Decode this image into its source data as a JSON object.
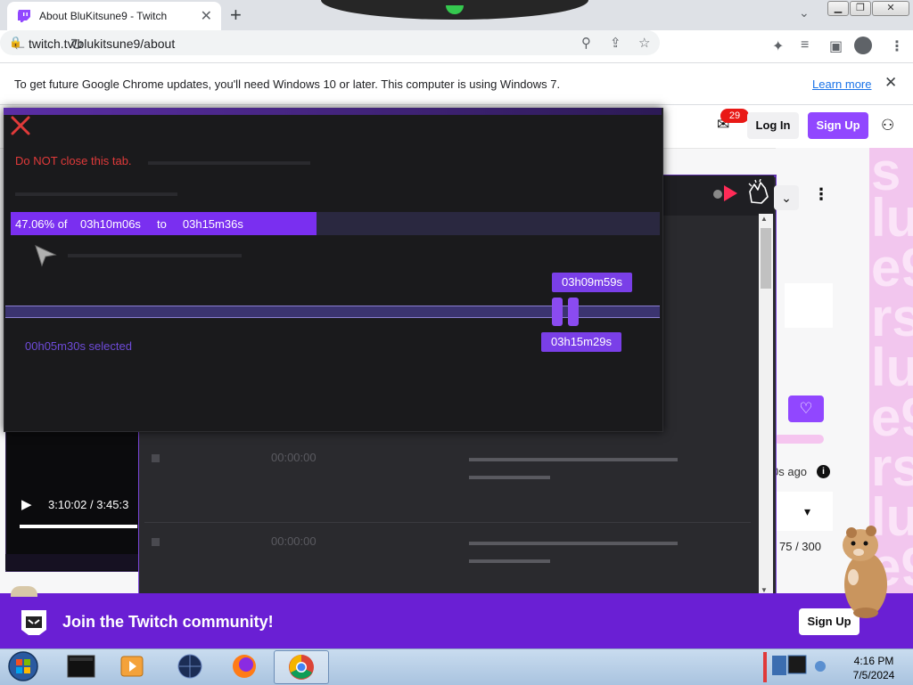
{
  "browser": {
    "tab_title": "About BluKitsune9 - Twitch",
    "url": "twitch.tv/blukitsune9/about",
    "new_tab_symbol": "+",
    "tab_close_symbol": "✕"
  },
  "infobar": {
    "message": "To get future Google Chrome updates, you'll need Windows 10 or later. This computer is using Windows 7.",
    "link": "Learn more"
  },
  "twitch": {
    "notification_count": "29",
    "login_label": "Log In",
    "signup_label": "Sign Up",
    "ago_text": "0s ago",
    "counter": "75 / 300",
    "join_text": "Join the Twitch community!",
    "join_signup_label": "Sign Up"
  },
  "player": {
    "time": "3:10:02 / 3:45:3"
  },
  "overlay": {
    "warning": "Do NOT close this tab.",
    "progress_text": "47.06% of    03h10m06s     to     03h15m36s",
    "progress_fraction": 0.4706,
    "handle_start_label": "03h09m59s",
    "handle_end_label": "03h15m29s",
    "selected_text": "00h05m30s selected"
  },
  "taskbar": {
    "time": "4:16 PM",
    "date": "7/5/2024"
  },
  "colors": {
    "twitch_purple": "#9147ff",
    "progress_purple": "#7a2ff0",
    "warning_red": "#e03a3a"
  }
}
